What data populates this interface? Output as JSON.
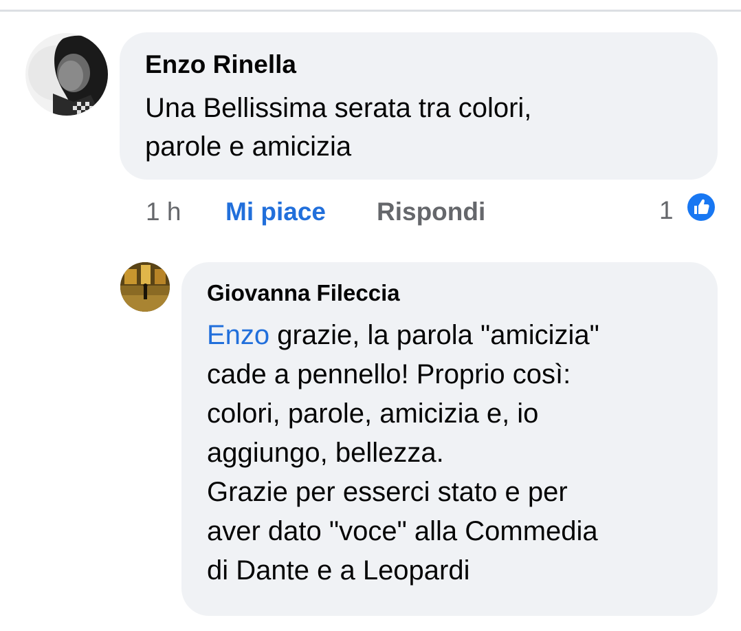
{
  "comments": [
    {
      "author": "Enzo Rinella",
      "lines": [
        "Una Bellissima serata tra colori,",
        "parole e amicizia"
      ],
      "time": "1 h",
      "like_label": "Mi piace",
      "reply_label": "Rispondi",
      "reaction_count": "1",
      "reaction_icon": "thumbs-up-icon"
    },
    {
      "author": "Giovanna Fileccia",
      "mention": "Enzo",
      "first_line_rest": " grazie, la parola \"amicizia\"",
      "lines": [
        "cade a pennello! Proprio così:",
        "colori, parole, amicizia e, io",
        "aggiungo, bellezza.",
        "Grazie per esserci stato e per",
        "aver dato \"voce\" alla Commedia",
        "di Dante e a Leopardi"
      ]
    }
  ],
  "colors": {
    "bubble": "#f0f2f5",
    "like_active": "#216fdb",
    "meta_gray": "#65676b",
    "reaction_blue": "#1877f2"
  }
}
